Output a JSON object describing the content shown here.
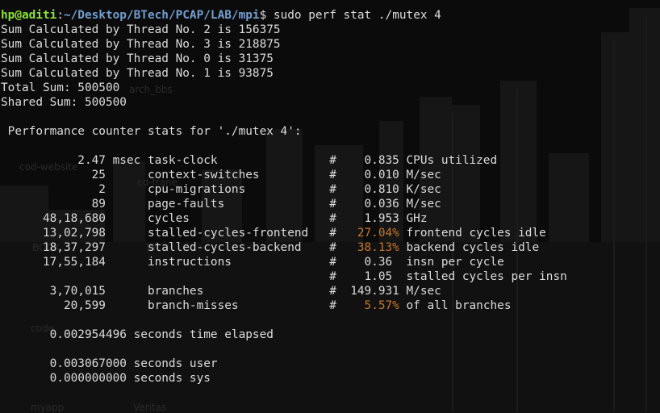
{
  "desktop": {
    "ghost_labels": [
      "arch_bbs",
      "cod-website",
      "cd-frane",
      "BOOK",
      "TY",
      "code",
      "myapp",
      "Veritas"
    ]
  },
  "terminal": {
    "prompt": {
      "user_host": "hp@aditi",
      "separator": ":",
      "path": "~/Desktop/BTech/PCAP/LAB/mpi",
      "symbol": "$",
      "command": " sudo perf stat ./mutex 4"
    },
    "output": {
      "thread_sums": [
        "Sum Calculated by Thread No. 2 is 156375",
        "Sum Calculated by Thread No. 3 is 218875",
        "Sum Calculated by Thread No. 0 is 31375",
        "Sum Calculated by Thread No. 1 is 93875"
      ],
      "total_sum": "Total Sum: 500500",
      "shared_sum": "Shared Sum: 500500",
      "perf_header": " Performance counter stats for './mutex 4':",
      "stats": [
        {
          "pre": "           2.47 msec task-clock                #    0.835 CPUs utilized",
          "pct": "",
          "post": ""
        },
        {
          "pre": "             25      context-switches          #    0.010 M/sec",
          "pct": "",
          "post": ""
        },
        {
          "pre": "              2      cpu-migrations            #    0.810 K/sec",
          "pct": "",
          "post": ""
        },
        {
          "pre": "             89      page-faults               #    0.036 M/sec",
          "pct": "",
          "post": ""
        },
        {
          "pre": "      48,18,680      cycles                    #    1.953 GHz",
          "pct": "",
          "post": ""
        },
        {
          "pre": "      13,02,798      stalled-cycles-frontend   #   ",
          "pct": "27.04%",
          "post": " frontend cycles idle"
        },
        {
          "pre": "      18,37,297      stalled-cycles-backend    #   ",
          "pct": "38.13%",
          "post": " backend cycles idle"
        },
        {
          "pre": "      17,55,184      instructions              #    0.36  insn per cycle",
          "pct": "",
          "post": ""
        },
        {
          "pre": "                                               #    1.05  stalled cycles per insn",
          "pct": "",
          "post": ""
        },
        {
          "pre": "       3,70,015      branches                  #  149.931 M/sec",
          "pct": "",
          "post": ""
        },
        {
          "pre": "         20,599      branch-misses             #    ",
          "pct": "5.57%",
          "post": " of all branches"
        }
      ],
      "time_elapsed": "       0.002954496 seconds time elapsed",
      "time_user": "       0.003067000 seconds user",
      "time_sys": "       0.000000000 seconds sys"
    }
  }
}
